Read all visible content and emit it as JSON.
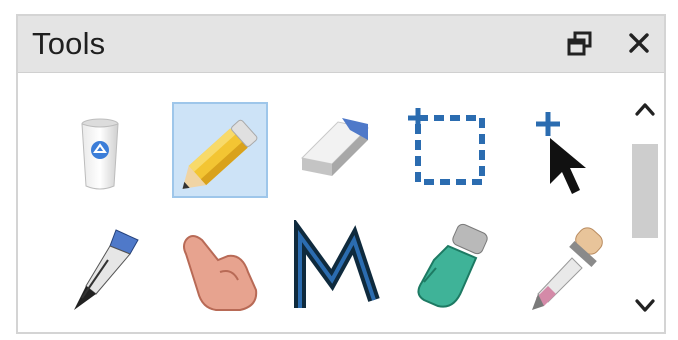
{
  "panel": {
    "title": "Tools",
    "float_icon": "restore-window-icon",
    "close_icon": "close-icon"
  },
  "tools": [
    {
      "icon": "recycle-bin-icon",
      "selected": false
    },
    {
      "icon": "pencil-icon",
      "selected": true
    },
    {
      "icon": "eraser-icon",
      "selected": false
    },
    {
      "icon": "rectangle-select-icon",
      "selected": false
    },
    {
      "icon": "pointer-add-icon",
      "selected": false
    },
    {
      "icon": "pen-nib-icon",
      "selected": false
    },
    {
      "icon": "hand-icon",
      "selected": false
    },
    {
      "icon": "magnet-m-icon",
      "selected": false
    },
    {
      "icon": "glove-icon",
      "selected": false
    },
    {
      "icon": "eyedropper-icon",
      "selected": false
    }
  ],
  "scrollbar": {
    "up_icon": "chevron-up-icon",
    "down_icon": "chevron-down-icon"
  },
  "colors": {
    "selection": "#cde3f7",
    "accent_blue": "#2b6cb0"
  }
}
